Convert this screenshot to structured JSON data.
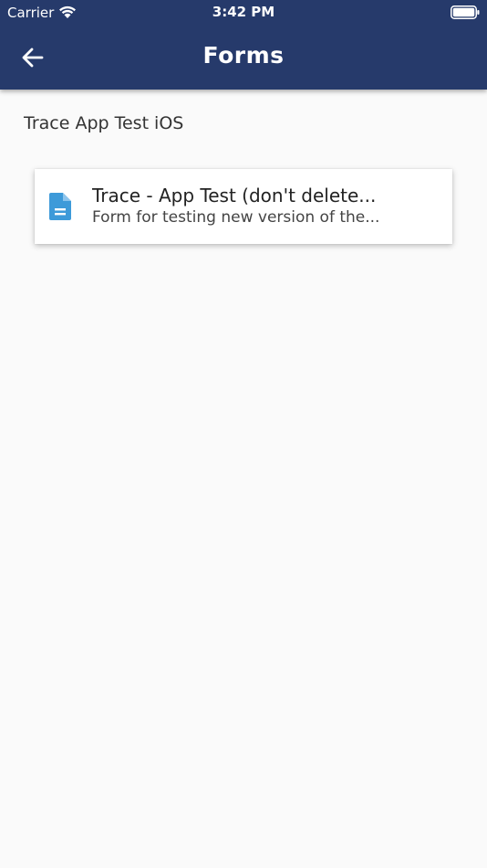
{
  "status_bar": {
    "carrier": "Carrier",
    "time": "3:42 PM"
  },
  "header": {
    "title": "Forms",
    "back_icon": "arrow-left-icon",
    "background_color": "#263a6b"
  },
  "section": {
    "label": "Trace App Test iOS"
  },
  "forms": [
    {
      "title": "Trace - App Test (don't delete...",
      "subtitle": "Form for testing new version of the...",
      "icon": "document-icon",
      "icon_color": "#3d9ad9"
    }
  ]
}
